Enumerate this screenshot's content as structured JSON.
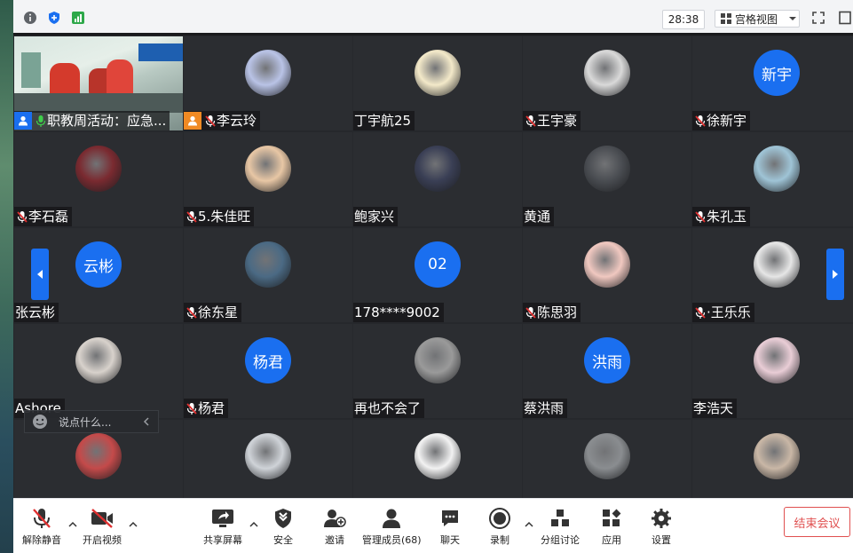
{
  "topbar": {
    "timer": "28:38",
    "view_label": "宫格视图",
    "icons": [
      "info-icon",
      "security-shield-icon",
      "signal-icon",
      "fullscreen-icon",
      "window-icon"
    ]
  },
  "tiles": [
    {
      "name": "职教周活动：应急...",
      "kind": "video",
      "mic": "on",
      "badge": true
    },
    {
      "name": "李云玲",
      "kind": "photo",
      "mic": "muted",
      "badge": true,
      "color": "#b9c3e6"
    },
    {
      "name": "丁宇航25",
      "kind": "photo",
      "mic": "none",
      "color": "#f3e9c9"
    },
    {
      "name": "王宇豪",
      "kind": "photo",
      "mic": "muted",
      "color": "#d9d9d9"
    },
    {
      "name": "徐新宇",
      "kind": "text",
      "avatar_text": "新宇",
      "mic": "muted"
    },
    {
      "name": "李石磊",
      "kind": "photo",
      "mic": "muted",
      "color": "#7a2a30"
    },
    {
      "name": "5.朱佳旺",
      "kind": "photo",
      "mic": "muted",
      "color": "#e8c7a5"
    },
    {
      "name": "鲍家兴",
      "kind": "photo",
      "mic": "none",
      "color": "#3a3f55"
    },
    {
      "name": "黄通",
      "kind": "photo",
      "mic": "none",
      "color": "#4a4d52"
    },
    {
      "name": "朱孔玉",
      "kind": "photo",
      "mic": "muted",
      "color": "#9fc4d6"
    },
    {
      "name": "张云彬",
      "kind": "text",
      "avatar_text": "云彬",
      "mic": "none"
    },
    {
      "name": "徐东星",
      "kind": "photo",
      "mic": "muted",
      "color": "#4b6a84"
    },
    {
      "name": "178****9002",
      "kind": "text",
      "avatar_text": "02",
      "mic": "none"
    },
    {
      "name": "陈思羽",
      "kind": "photo",
      "mic": "muted",
      "color": "#f0c8c0"
    },
    {
      "name": "·王乐乐",
      "kind": "photo",
      "mic": "muted",
      "color": "#e6e6e6"
    },
    {
      "name": "Ashore",
      "kind": "photo",
      "mic": "none",
      "color": "#d8d2cc"
    },
    {
      "name": "杨君",
      "kind": "text",
      "avatar_text": "杨君",
      "mic": "muted"
    },
    {
      "name": "再也不会了",
      "kind": "photo",
      "mic": "none",
      "color": "#9a9a9a"
    },
    {
      "name": "蔡洪雨",
      "kind": "text",
      "avatar_text": "洪雨",
      "mic": "none"
    },
    {
      "name": "李浩天",
      "kind": "photo",
      "mic": "none",
      "color": "#e9cdd6"
    },
    {
      "name": "",
      "kind": "photo",
      "mic": "none",
      "color": "#c44a4a"
    },
    {
      "name": "",
      "kind": "photo",
      "mic": "none",
      "color": "#cfd3d8"
    },
    {
      "name": "",
      "kind": "photo",
      "mic": "none",
      "color": "#f2f2f2"
    },
    {
      "name": "",
      "kind": "photo",
      "mic": "none",
      "color": "#8a8d90"
    },
    {
      "name": "",
      "kind": "photo",
      "mic": "none",
      "color": "#c9b7a6"
    }
  ],
  "chat": {
    "placeholder": "说点什么..."
  },
  "toolbar": {
    "unmute": "解除静音",
    "start_video": "开启视频",
    "share": "共享屏幕",
    "security": "安全",
    "invite": "邀请",
    "members": "管理成员(68)",
    "chat": "聊天",
    "record": "录制",
    "breakout": "分组讨论",
    "apps": "应用",
    "settings": "设置",
    "end": "结束会议"
  },
  "colors": {
    "accent": "#1a6ff0",
    "end": "#e05050",
    "tile_bg": "#2b2d31"
  }
}
